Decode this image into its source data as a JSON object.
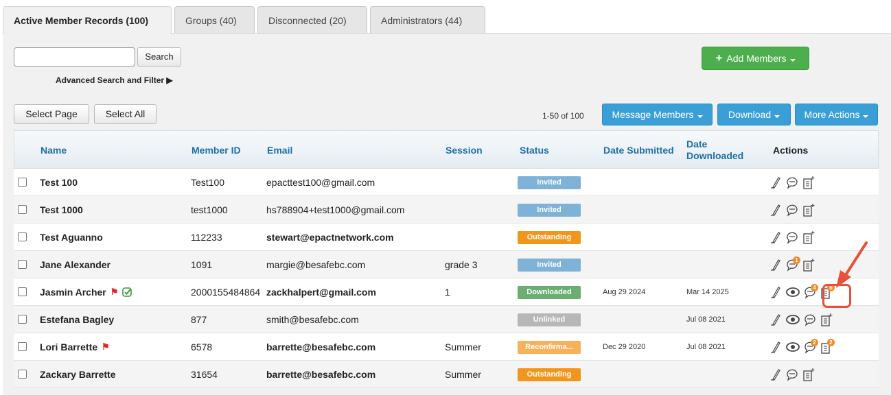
{
  "tabs": [
    {
      "label": "Active Member Records (100)",
      "active": true
    },
    {
      "label": "Groups (40)",
      "active": false
    },
    {
      "label": "Disconnected (20)",
      "active": false
    },
    {
      "label": "Administrators (44)",
      "active": false
    }
  ],
  "search": {
    "placeholder": "",
    "button": "Search",
    "advanced": "Advanced Search and Filter ▶"
  },
  "add_members": "Add Members",
  "select_page": "Select Page",
  "select_all": "Select All",
  "paging": "1-50 of 100",
  "message_members": "Message Members",
  "download": "Download",
  "more_actions": "More Actions",
  "columns": {
    "name": "Name",
    "member_id": "Member ID",
    "email": "Email",
    "session": "Session",
    "status": "Status",
    "date_submitted": "Date Submitted",
    "date_downloaded": "Date Downloaded",
    "actions": "Actions"
  },
  "status_colors": {
    "Invited": "#7eb2d6",
    "Outstanding": "#f0961d",
    "Downloaded": "#6aae72",
    "Unlinked": "#b7b7b7",
    "Reconfirma...": "#f6b25a"
  },
  "rows": [
    {
      "name": "Test 100",
      "member_id": "Test100",
      "email": "epacttest100@gmail.com",
      "email_bold": false,
      "session": "",
      "status": "Invited",
      "submitted": "",
      "downloaded": "",
      "flag": false,
      "verified": false,
      "eye": false,
      "msg_count": "",
      "doc_count": ""
    },
    {
      "name": "Test 1000",
      "member_id": "test1000",
      "email": "hs788904+test1000@gmail.com",
      "email_bold": false,
      "session": "",
      "status": "Invited",
      "submitted": "",
      "downloaded": "",
      "flag": false,
      "verified": false,
      "eye": false,
      "msg_count": "",
      "doc_count": ""
    },
    {
      "name": "Test Aguanno",
      "member_id": "112233",
      "email": "stewart@epactnetwork.com",
      "email_bold": true,
      "session": "",
      "status": "Outstanding",
      "submitted": "",
      "downloaded": "",
      "flag": false,
      "verified": false,
      "eye": false,
      "msg_count": "",
      "doc_count": ""
    },
    {
      "name": "Jane Alexander",
      "member_id": "1091",
      "email": "margie@besafebc.com",
      "email_bold": false,
      "session": "grade 3",
      "status": "Invited",
      "submitted": "",
      "downloaded": "",
      "flag": false,
      "verified": false,
      "eye": false,
      "msg_count": "1",
      "doc_count": ""
    },
    {
      "name": "Jasmin Archer",
      "member_id": "2000155484864",
      "email": "zackhalpert@gmail.com",
      "email_bold": true,
      "session": "1",
      "status": "Downloaded",
      "submitted": "Aug 29 2024",
      "downloaded": "Mar 14 2025",
      "flag": true,
      "verified": true,
      "eye": true,
      "msg_count": "4",
      "doc_count": "6"
    },
    {
      "name": "Estefana Bagley",
      "member_id": "877",
      "email": "smith@besafebc.com",
      "email_bold": false,
      "session": "",
      "status": "Unlinked",
      "submitted": "",
      "downloaded": "Jul 08 2021",
      "flag": false,
      "verified": false,
      "eye": true,
      "msg_count": "",
      "doc_count": ""
    },
    {
      "name": "Lori Barrette",
      "member_id": "6578",
      "email": "barrette@besafebc.com",
      "email_bold": true,
      "session": "Summer",
      "status": "Reconfirma...",
      "submitted": "Dec 29 2020",
      "downloaded": "Jul 08 2021",
      "flag": true,
      "verified": false,
      "eye": true,
      "msg_count": "2",
      "doc_count": "2"
    },
    {
      "name": "Zackary Barrette",
      "member_id": "31654",
      "email": "barrette@besafebc.com",
      "email_bold": true,
      "session": "Summer",
      "status": "Outstanding",
      "submitted": "",
      "downloaded": "",
      "flag": false,
      "verified": false,
      "eye": false,
      "msg_count": "",
      "doc_count": ""
    }
  ]
}
